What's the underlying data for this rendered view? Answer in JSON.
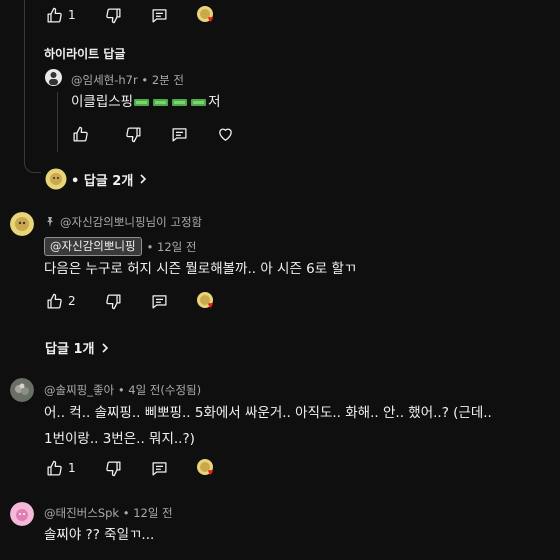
{
  "top_actions": {
    "like_count": "1"
  },
  "highlight": {
    "section_label": "하이라이트 답글",
    "author": "@임세현-h7r",
    "time": "• 2분 전",
    "text_prefix": "이클립스핑",
    "text_suffix": "저",
    "emoji_icon": "green-money-icon",
    "emoji_count": 4
  },
  "replies_toggle_1": {
    "label": "• 답글 2개"
  },
  "pinned": {
    "pin_label": "@자신감의뽀니핑님이 고정함",
    "author": "@자신감의뽀니핑",
    "time": "• 12일 전",
    "text": "다음은 누구로 허지 시즌 뭘로해볼까.. 아 시즌 6로 할ㄲ",
    "like_count": "2",
    "replies_label": "답글 1개"
  },
  "comment2": {
    "author": "@솔찌핑_좋아",
    "time": "• 4일 전(수정됨)",
    "line1": "어.. 컥.. 솔찌핑.. 삐뽀핑.. 5화에서 싸운거.. 아직도.. 화해.. 안.. 했어..? (근데..",
    "line2": "1번이랑.. 3번은.. 뭐지..?)",
    "like_count": "1"
  },
  "comment3": {
    "author": "@태진버스Spk",
    "time": "• 12일 전",
    "text": "솔찌야 ?? 죽일ㄲ..."
  },
  "colors": {
    "background": "#0f0f0f",
    "text": "#f1f1f1",
    "muted": "#aaaaaa",
    "heart_red": "#e62117"
  }
}
